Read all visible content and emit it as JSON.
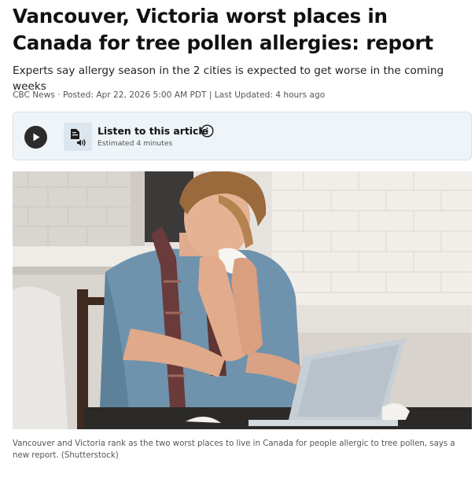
{
  "article": {
    "headline": "Vancouver, Victoria worst places in Canada for tree pollen allergies: report",
    "deck": "Experts say allergy season in the 2 cities is expected to get worse in the coming weeks",
    "byline": "CBC News · Posted: Apr 22, 2026 5:00 AM PDT | Last Updated: 4 hours ago"
  },
  "audio": {
    "play_icon": "play-icon",
    "doc_icon": "document-audio-icon",
    "title": "Listen to this article",
    "subtitle": "Estimated 4 minutes",
    "info_icon": "info-icon"
  },
  "photo": {
    "description_icon": "photo-man-sneezing-at-laptop",
    "caption": "Vancouver and Victoria rank as the two worst places to live in Canada for people allergic to tree pollen, says a new report. (Shutterstock)"
  },
  "colors": {
    "card_background": "#eef4f8",
    "card_border": "#d6e0e7",
    "play_button": "#2b2b2b",
    "headline": "#111111"
  }
}
